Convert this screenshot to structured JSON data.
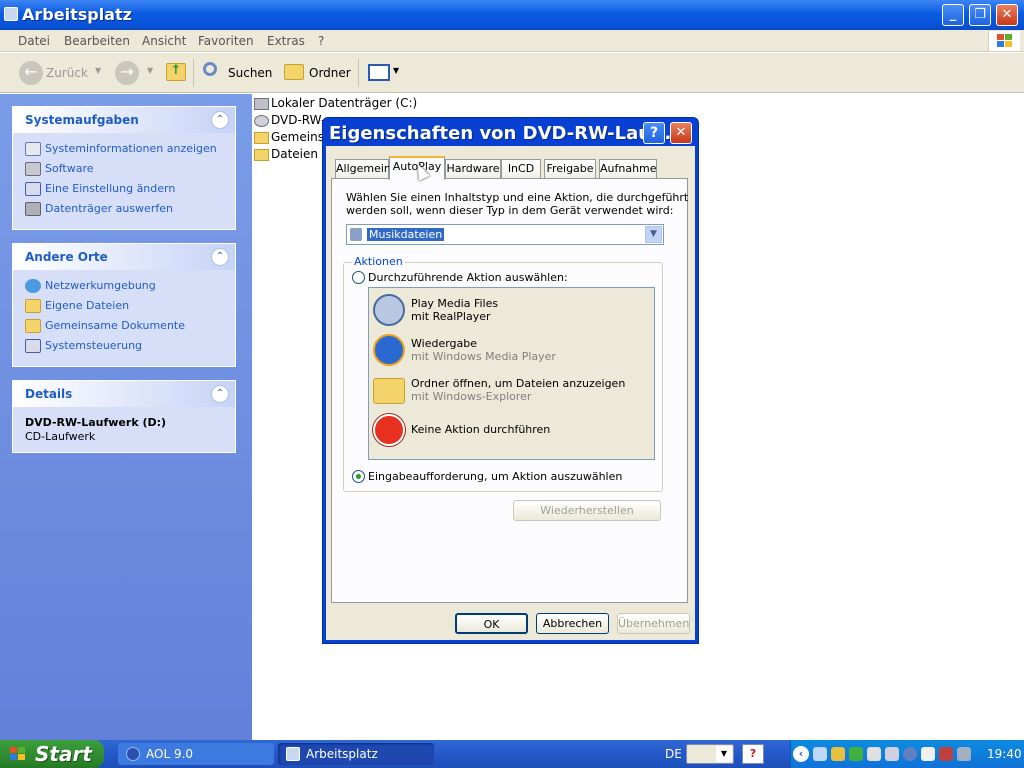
{
  "window": {
    "title": "Arbeitsplatz"
  },
  "menubar": {
    "items": [
      "Datei",
      "Bearbeiten",
      "Ansicht",
      "Favoriten",
      "Extras",
      "?"
    ]
  },
  "toolbar": {
    "back": "Zurück",
    "search": "Suchen",
    "folders": "Ordner"
  },
  "sidebar": {
    "system_tasks": {
      "title": "Systemaufgaben",
      "items": [
        "Systeminformationen anzeigen",
        "Software",
        "Eine Einstellung ändern",
        "Datenträger auswerfen"
      ]
    },
    "other_places": {
      "title": "Andere Orte",
      "items": [
        "Netzwerkumgebung",
        "Eigene Dateien",
        "Gemeinsame Dokumente",
        "Systemsteuerung"
      ]
    },
    "details": {
      "title": "Details",
      "name": "DVD-RW-Laufwerk (D:)",
      "type": "CD-Laufwerk"
    }
  },
  "content": {
    "items": [
      "Lokaler Datenträger (C:)",
      "DVD-RW-",
      "Gemeinsa",
      "Dateien v"
    ]
  },
  "dialog": {
    "title": "Eigenschaften von DVD-RW-Lauf…",
    "tabs": [
      "Allgemein",
      "AutoPlay",
      "Hardware",
      "InCD",
      "Freigabe",
      "Aufnahme"
    ],
    "prompt_line1": "Wählen Sie einen Inhaltstyp und eine Aktion, die durchgeführt",
    "prompt_line2": "werden soll, wenn dieser Typ in dem Gerät verwendet wird:",
    "content_type": "Musikdateien",
    "actions_legend": "Aktionen",
    "radio_select": "Durchzuführende Aktion auswählen:",
    "actions": [
      {
        "title": "Play Media Files",
        "sub": "mit RealPlayer"
      },
      {
        "title": "Wiedergabe",
        "sub": "mit Windows Media Player"
      },
      {
        "title": "Ordner öffnen, um Dateien anzuzeigen",
        "sub": "mit Windows-Explorer"
      },
      {
        "title": "Keine Aktion durchführen",
        "sub": ""
      }
    ],
    "radio_prompt": "Eingabeaufforderung, um Aktion auszuwählen",
    "restore": "Wiederherstellen",
    "ok": "OK",
    "cancel": "Abbrechen",
    "apply": "Übernehmen"
  },
  "taskbar": {
    "start": "Start",
    "tasks": [
      "AOL 9.0",
      "Arbeitsplatz"
    ],
    "lang": "DE",
    "clock": "19:40"
  },
  "colors": {
    "titlebar": "#0a5be0",
    "sidebar": "#7a9de8",
    "link": "#215dc6",
    "start": "#2f8a2f"
  }
}
